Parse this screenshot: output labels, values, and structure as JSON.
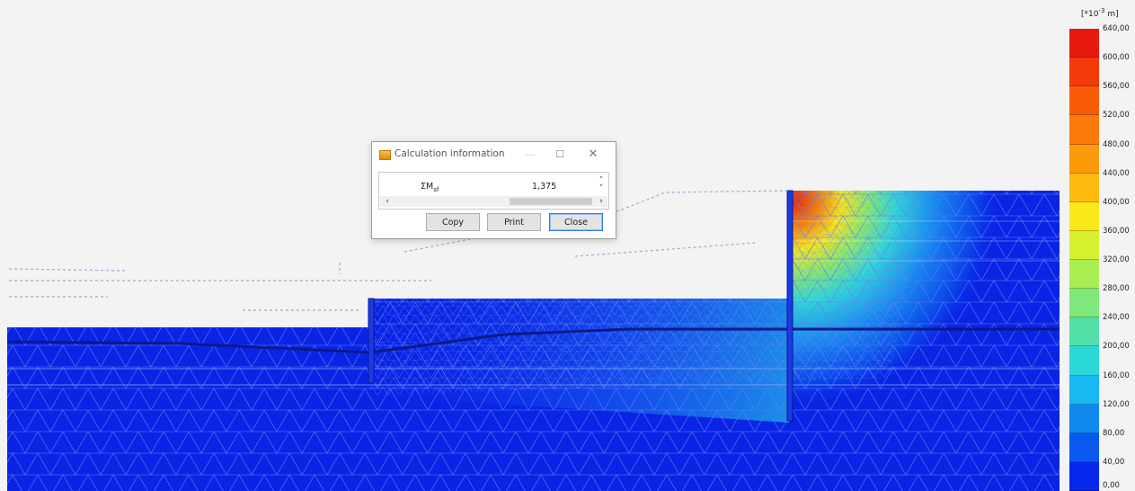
{
  "dialog": {
    "title": "Calculation information",
    "result_label": "ΣM",
    "result_label_sub": "sf",
    "result_value": "1,375",
    "buttons": {
      "copy": "Copy",
      "print": "Print",
      "close": "Close"
    }
  },
  "legend": {
    "unit_prefix": "[*10",
    "unit_exponent": "-3",
    "unit_suffix": " m]",
    "ticks": [
      "640,00",
      "600,00",
      "560,00",
      "520,00",
      "480,00",
      "440,00",
      "400,00",
      "360,00",
      "320,00",
      "280,00",
      "240,00",
      "200,00",
      "160,00",
      "120,00",
      "80,00",
      "40,00",
      "0,00"
    ],
    "colors": [
      "#e81a10",
      "#f23a0a",
      "#f95a08",
      "#fc7a08",
      "#fd9a0a",
      "#fdbb10",
      "#fbe81a",
      "#d6f030",
      "#a8ee50",
      "#7ee87a",
      "#52e0a8",
      "#2ad8d8",
      "#18b8f0",
      "#1088f0",
      "#0a58f0",
      "#0628ee"
    ]
  },
  "model": {
    "domain_color": "#0a24e6"
  }
}
